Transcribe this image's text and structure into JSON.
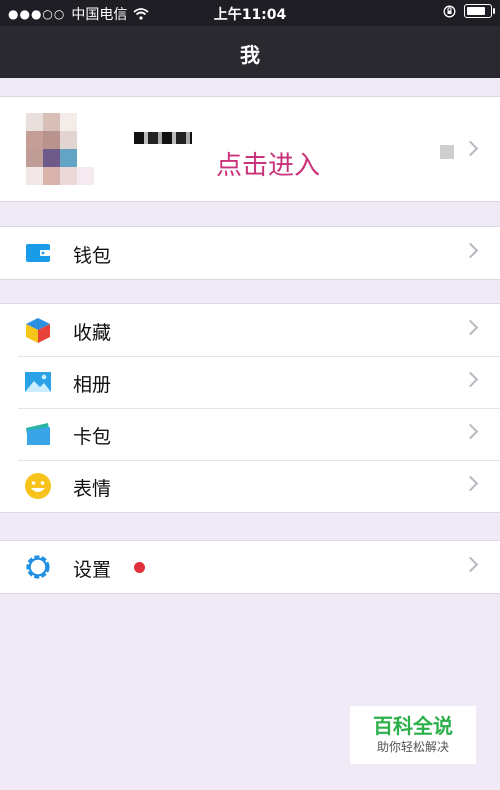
{
  "status_bar": {
    "signal": "●●●○○",
    "carrier": "中国电信",
    "time": "上午11:04"
  },
  "nav": {
    "title": "我"
  },
  "profile": {
    "enter_label": "点击进入"
  },
  "sections": {
    "wallet": [
      {
        "label": "钱包",
        "icon": "wallet-icon"
      }
    ],
    "collections": [
      {
        "label": "收藏",
        "icon": "favorites-cube-icon"
      },
      {
        "label": "相册",
        "icon": "album-icon"
      },
      {
        "label": "卡包",
        "icon": "card-icon"
      },
      {
        "label": "表情",
        "icon": "emoji-icon"
      }
    ],
    "settings": [
      {
        "label": "设置",
        "icon": "gear-icon",
        "badge_color": "#e0303b"
      }
    ]
  },
  "watermark": {
    "brand": "百科全说",
    "tagline": "助你轻松解决"
  },
  "colors": {
    "enter_text": "#c8337b",
    "nav_bg": "#2a2930",
    "page_bg": "#efeaf6",
    "watermark_green": "#2db04a"
  }
}
